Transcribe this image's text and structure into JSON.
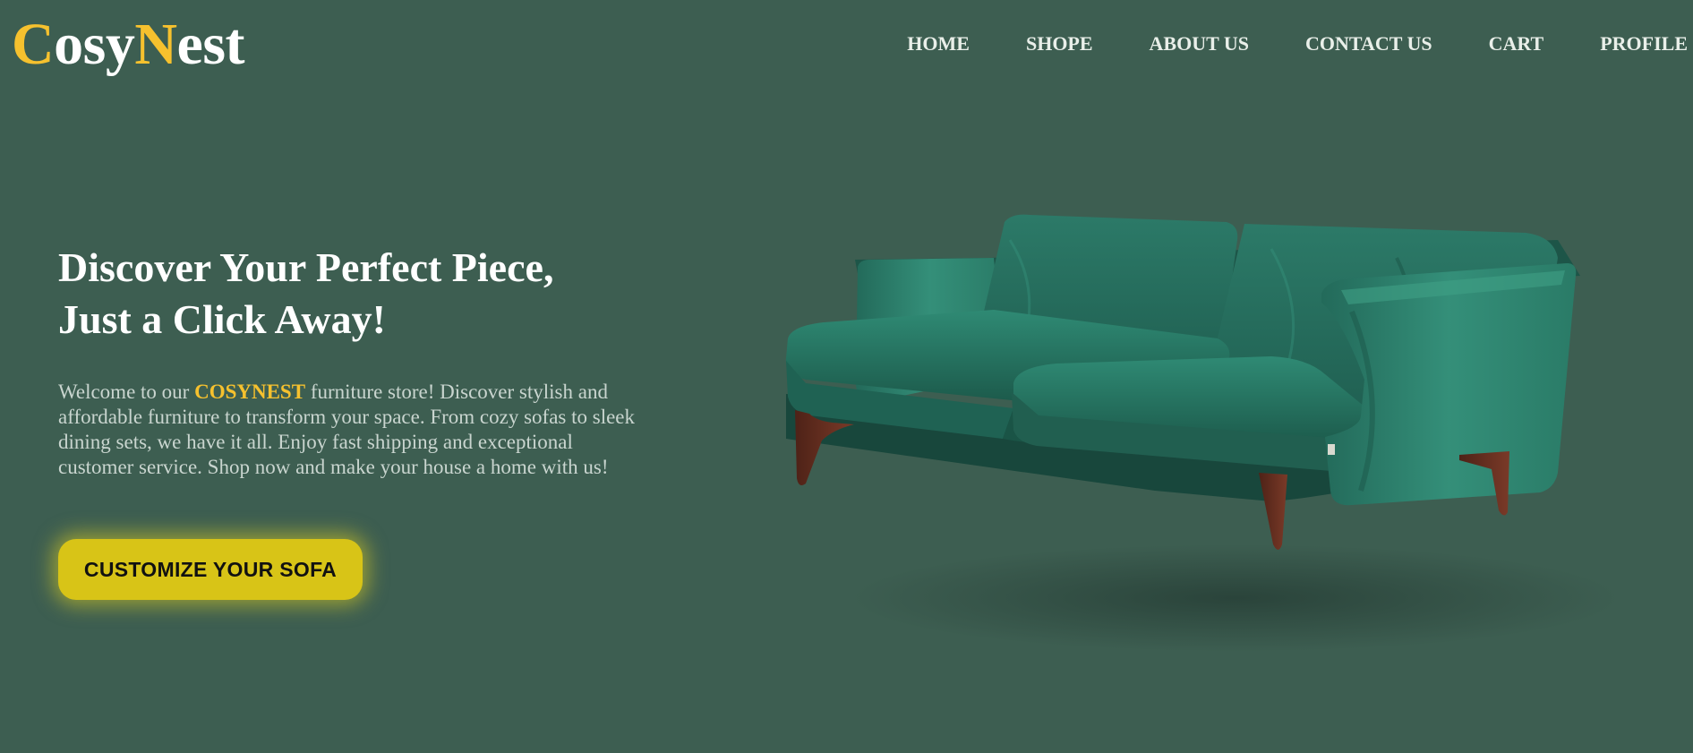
{
  "brand": {
    "logo_c": "C",
    "logo_osy": "osy",
    "logo_n": "N",
    "logo_est": "est",
    "accent_color": "#f6c12e",
    "background_color": "#3d5e51"
  },
  "nav": {
    "items": [
      {
        "label": "HOME"
      },
      {
        "label": "SHOPE"
      },
      {
        "label": "ABOUT US"
      },
      {
        "label": "CONTACT US"
      },
      {
        "label": "CART"
      },
      {
        "label": "PROFILE"
      }
    ]
  },
  "hero": {
    "title_line1": "Discover Your Perfect Piece,",
    "title_line2": "Just a Click Away!",
    "text_before": "Welcome to our ",
    "text_brand": "COSYNEST",
    "text_after": " furniture store! Discover stylish and affordable furniture to transform your space. From cozy sofas to sleek dining sets, we have it all. Enjoy fast shipping and exceptional customer service. Shop now and make your house a home with us!",
    "cta_label": "CUSTOMIZE YOUR SOFA",
    "cta_color": "#d8c417"
  },
  "image": {
    "name": "green-velvet-sofa-image"
  }
}
